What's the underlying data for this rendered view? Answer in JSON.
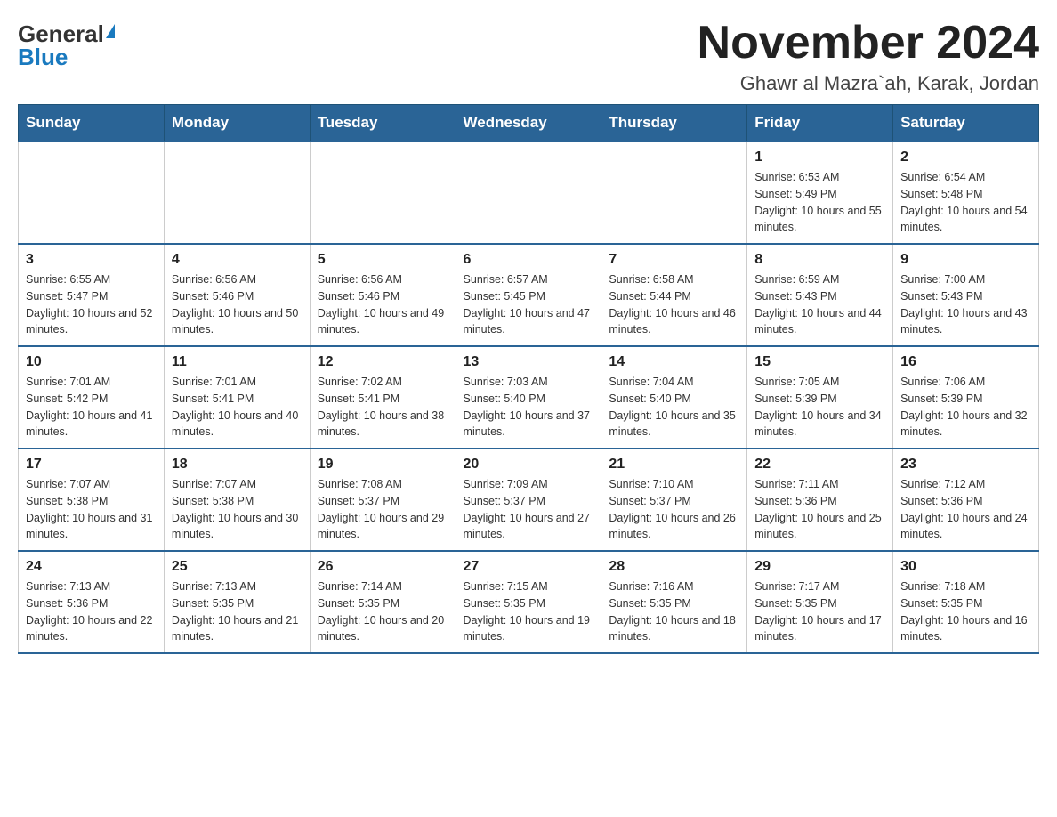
{
  "header": {
    "logo_general": "General",
    "logo_blue": "Blue",
    "title": "November 2024",
    "subtitle": "Ghawr al Mazra`ah, Karak, Jordan"
  },
  "calendar": {
    "days_of_week": [
      "Sunday",
      "Monday",
      "Tuesday",
      "Wednesday",
      "Thursday",
      "Friday",
      "Saturday"
    ],
    "weeks": [
      [
        {
          "day": "",
          "info": ""
        },
        {
          "day": "",
          "info": ""
        },
        {
          "day": "",
          "info": ""
        },
        {
          "day": "",
          "info": ""
        },
        {
          "day": "",
          "info": ""
        },
        {
          "day": "1",
          "info": "Sunrise: 6:53 AM\nSunset: 5:49 PM\nDaylight: 10 hours and 55 minutes."
        },
        {
          "day": "2",
          "info": "Sunrise: 6:54 AM\nSunset: 5:48 PM\nDaylight: 10 hours and 54 minutes."
        }
      ],
      [
        {
          "day": "3",
          "info": "Sunrise: 6:55 AM\nSunset: 5:47 PM\nDaylight: 10 hours and 52 minutes."
        },
        {
          "day": "4",
          "info": "Sunrise: 6:56 AM\nSunset: 5:46 PM\nDaylight: 10 hours and 50 minutes."
        },
        {
          "day": "5",
          "info": "Sunrise: 6:56 AM\nSunset: 5:46 PM\nDaylight: 10 hours and 49 minutes."
        },
        {
          "day": "6",
          "info": "Sunrise: 6:57 AM\nSunset: 5:45 PM\nDaylight: 10 hours and 47 minutes."
        },
        {
          "day": "7",
          "info": "Sunrise: 6:58 AM\nSunset: 5:44 PM\nDaylight: 10 hours and 46 minutes."
        },
        {
          "day": "8",
          "info": "Sunrise: 6:59 AM\nSunset: 5:43 PM\nDaylight: 10 hours and 44 minutes."
        },
        {
          "day": "9",
          "info": "Sunrise: 7:00 AM\nSunset: 5:43 PM\nDaylight: 10 hours and 43 minutes."
        }
      ],
      [
        {
          "day": "10",
          "info": "Sunrise: 7:01 AM\nSunset: 5:42 PM\nDaylight: 10 hours and 41 minutes."
        },
        {
          "day": "11",
          "info": "Sunrise: 7:01 AM\nSunset: 5:41 PM\nDaylight: 10 hours and 40 minutes."
        },
        {
          "day": "12",
          "info": "Sunrise: 7:02 AM\nSunset: 5:41 PM\nDaylight: 10 hours and 38 minutes."
        },
        {
          "day": "13",
          "info": "Sunrise: 7:03 AM\nSunset: 5:40 PM\nDaylight: 10 hours and 37 minutes."
        },
        {
          "day": "14",
          "info": "Sunrise: 7:04 AM\nSunset: 5:40 PM\nDaylight: 10 hours and 35 minutes."
        },
        {
          "day": "15",
          "info": "Sunrise: 7:05 AM\nSunset: 5:39 PM\nDaylight: 10 hours and 34 minutes."
        },
        {
          "day": "16",
          "info": "Sunrise: 7:06 AM\nSunset: 5:39 PM\nDaylight: 10 hours and 32 minutes."
        }
      ],
      [
        {
          "day": "17",
          "info": "Sunrise: 7:07 AM\nSunset: 5:38 PM\nDaylight: 10 hours and 31 minutes."
        },
        {
          "day": "18",
          "info": "Sunrise: 7:07 AM\nSunset: 5:38 PM\nDaylight: 10 hours and 30 minutes."
        },
        {
          "day": "19",
          "info": "Sunrise: 7:08 AM\nSunset: 5:37 PM\nDaylight: 10 hours and 29 minutes."
        },
        {
          "day": "20",
          "info": "Sunrise: 7:09 AM\nSunset: 5:37 PM\nDaylight: 10 hours and 27 minutes."
        },
        {
          "day": "21",
          "info": "Sunrise: 7:10 AM\nSunset: 5:37 PM\nDaylight: 10 hours and 26 minutes."
        },
        {
          "day": "22",
          "info": "Sunrise: 7:11 AM\nSunset: 5:36 PM\nDaylight: 10 hours and 25 minutes."
        },
        {
          "day": "23",
          "info": "Sunrise: 7:12 AM\nSunset: 5:36 PM\nDaylight: 10 hours and 24 minutes."
        }
      ],
      [
        {
          "day": "24",
          "info": "Sunrise: 7:13 AM\nSunset: 5:36 PM\nDaylight: 10 hours and 22 minutes."
        },
        {
          "day": "25",
          "info": "Sunrise: 7:13 AM\nSunset: 5:35 PM\nDaylight: 10 hours and 21 minutes."
        },
        {
          "day": "26",
          "info": "Sunrise: 7:14 AM\nSunset: 5:35 PM\nDaylight: 10 hours and 20 minutes."
        },
        {
          "day": "27",
          "info": "Sunrise: 7:15 AM\nSunset: 5:35 PM\nDaylight: 10 hours and 19 minutes."
        },
        {
          "day": "28",
          "info": "Sunrise: 7:16 AM\nSunset: 5:35 PM\nDaylight: 10 hours and 18 minutes."
        },
        {
          "day": "29",
          "info": "Sunrise: 7:17 AM\nSunset: 5:35 PM\nDaylight: 10 hours and 17 minutes."
        },
        {
          "day": "30",
          "info": "Sunrise: 7:18 AM\nSunset: 5:35 PM\nDaylight: 10 hours and 16 minutes."
        }
      ]
    ]
  }
}
